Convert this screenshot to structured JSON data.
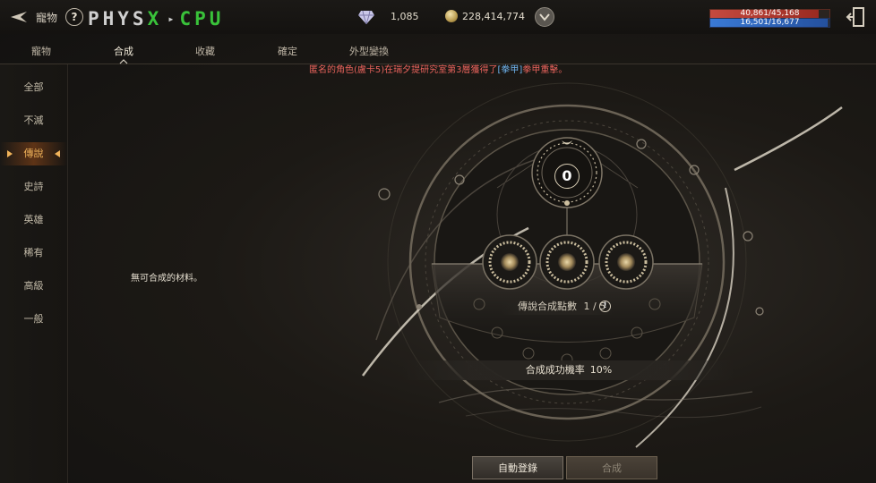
{
  "topbar": {
    "title": "寵物",
    "help": "?",
    "logo_left": "PHYS",
    "logo_x": "X",
    "logo_right": "CPU",
    "gem_value": "1,085",
    "gold_value": "228,414,774",
    "hp_text": "40,861/45,168",
    "mp_text": "16,501/16,677",
    "hp_fraction": 0.905,
    "mp_fraction": 0.99
  },
  "tabs": [
    "寵物",
    "合成",
    "收藏",
    "確定",
    "外型變換"
  ],
  "active_tab": "合成",
  "notice": {
    "prefix": "匿名的角色(盧卡5)在瑞夕提研究室第3層獲得了",
    "item": "[拳甲]",
    "item_name": "拳甲重擊",
    "suffix": "。"
  },
  "sidebar": {
    "items": [
      "全部",
      "不滅",
      "傳說",
      "史詩",
      "英雄",
      "稀有",
      "高級",
      "一般"
    ],
    "active": "傳說"
  },
  "main": {
    "empty_message": "無可合成的材料。",
    "center_count": "0",
    "points_label": "傳說合成點數",
    "points_value": "1 / 5",
    "points_info": "!",
    "rate_label": "合成成功機率",
    "rate_value": "10%"
  },
  "buttons": {
    "auto_register": "自動登錄",
    "synthesize": "合成"
  },
  "colors": {
    "accent": "#f0b35a",
    "notice_red": "#e9635c",
    "notice_blue": "#6fb4ef",
    "logo_green": "#39c23a"
  }
}
